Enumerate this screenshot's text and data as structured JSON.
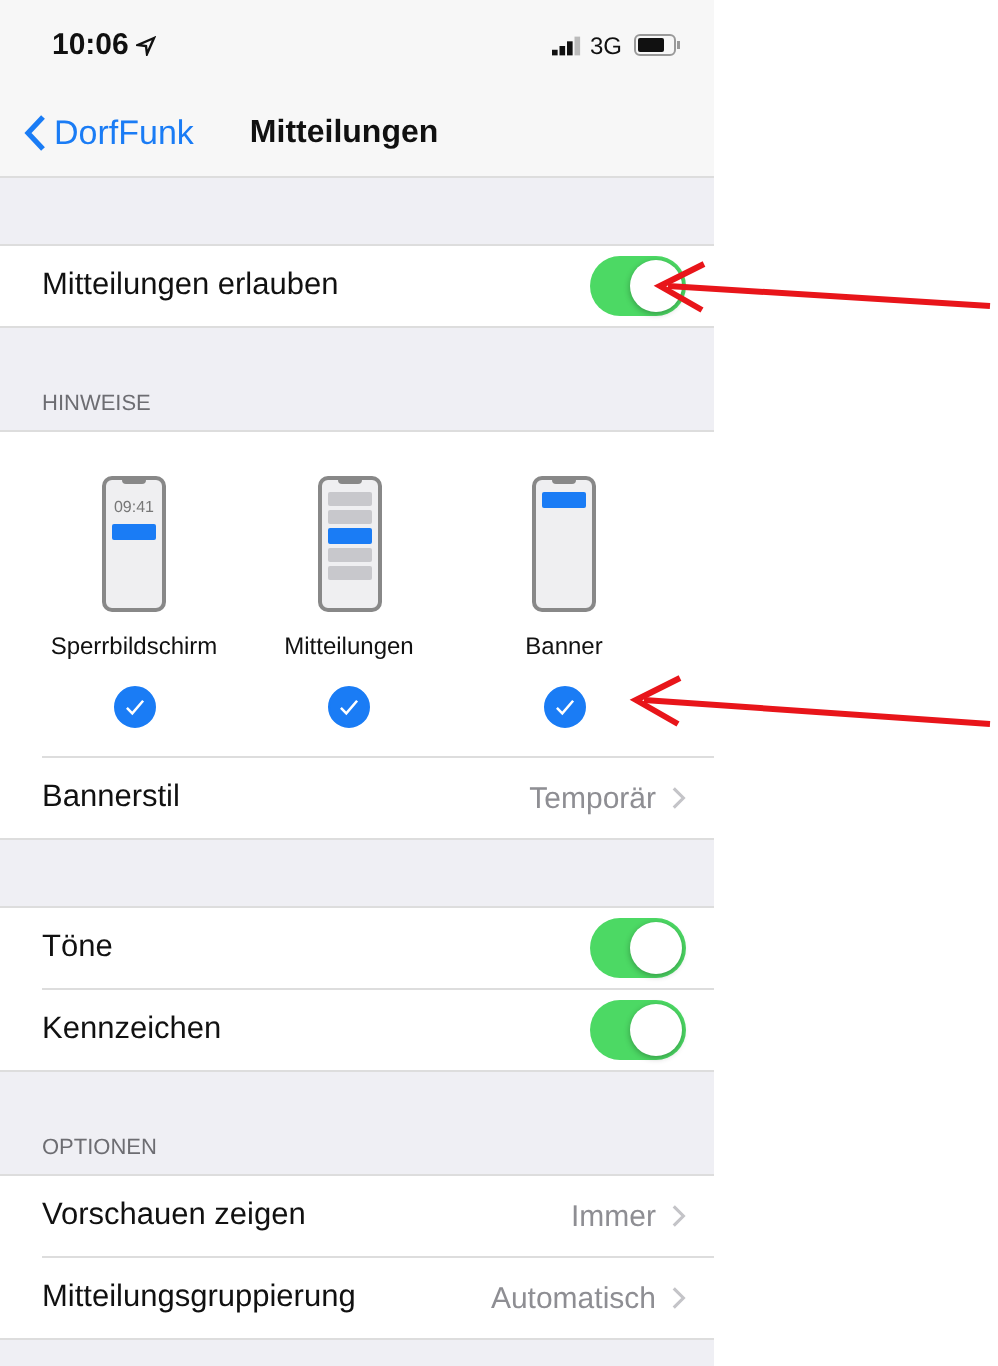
{
  "status_bar": {
    "time": "10:06",
    "network": "3G"
  },
  "nav": {
    "back": "DorfFunk",
    "title": "Mitteilungen"
  },
  "allow_row": {
    "label": "Mitteilungen erlauben",
    "kind": "toggle",
    "on": true
  },
  "alerts_section": {
    "header": "HINWEISE",
    "styles": [
      {
        "label": "Sperrbildschirm",
        "kind": "lockscreen",
        "preview_time": "09:41",
        "checked": true
      },
      {
        "label": "Mitteilungen",
        "kind": "list",
        "checked": true
      },
      {
        "label": "Banner",
        "kind": "banner",
        "checked": true
      }
    ],
    "rows": [
      {
        "label": "Bannerstil",
        "kind": "disclosure",
        "value": "Temporär"
      }
    ]
  },
  "sound_rows": [
    {
      "label": "Töne",
      "kind": "toggle",
      "on": true
    },
    {
      "label": "Kennzeichen",
      "kind": "toggle",
      "on": true
    }
  ],
  "options_section": {
    "header": "OPTIONEN",
    "rows": [
      {
        "label": "Vorschauen zeigen",
        "kind": "disclosure",
        "value": "Immer"
      },
      {
        "label": "Mitteilungsgruppierung",
        "kind": "disclosure",
        "value": "Automatisch"
      }
    ]
  },
  "annotations": [
    {
      "kind": "arrow"
    },
    {
      "kind": "arrow"
    }
  ]
}
